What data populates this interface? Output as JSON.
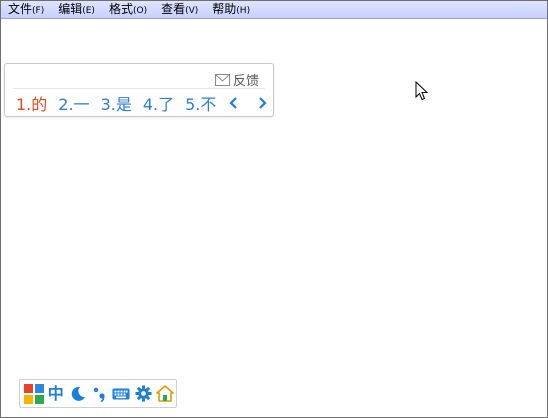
{
  "menubar": {
    "items": [
      {
        "label": "文件",
        "key": "(F)"
      },
      {
        "label": "编辑",
        "key": "(E)"
      },
      {
        "label": "格式",
        "key": "(O)"
      },
      {
        "label": "查看",
        "key": "(V)"
      },
      {
        "label": "帮助",
        "key": "(H)"
      }
    ]
  },
  "ime_popup": {
    "feedback_label": "反馈",
    "candidates": [
      "1.的",
      "2.一",
      "3.是",
      "4.了",
      "5.不"
    ],
    "selected_index": 0,
    "prev_icon": "chevron-left-icon",
    "next_icon": "chevron-right-icon"
  },
  "ime_toolbar": {
    "mode_label": "中",
    "icons": [
      "logo-icon",
      "moon-icon",
      "punctuation-icon",
      "keyboard-icon",
      "gear-icon",
      "home-icon"
    ]
  },
  "colors": {
    "menubar_bg": "#c9d0ff",
    "candidate_selected": "#e04a1a",
    "candidate": "#2d7ed6",
    "caret": "#d40000"
  }
}
